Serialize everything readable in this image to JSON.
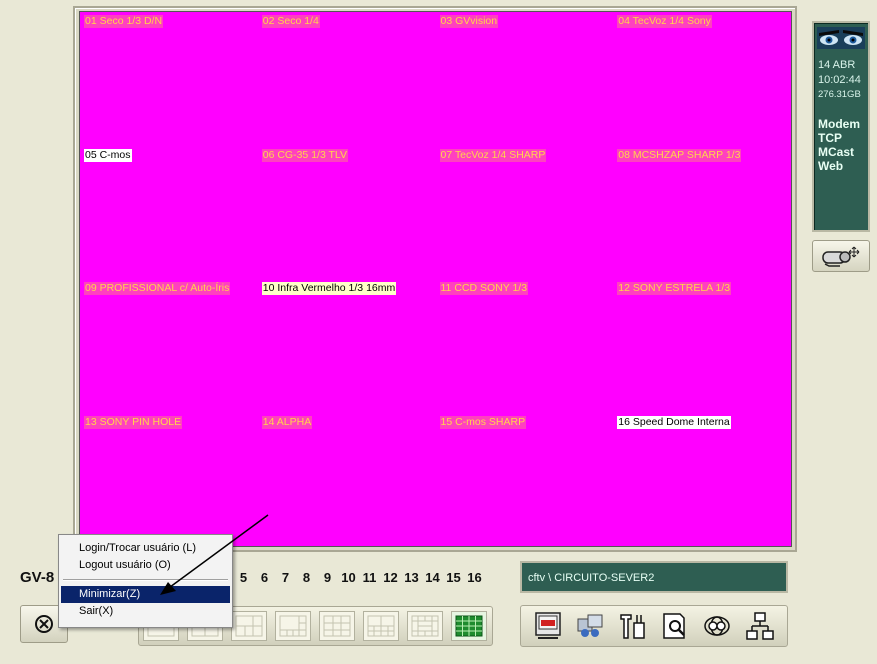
{
  "cameras": [
    {
      "label": "01 Seco 1/3 D/N",
      "state": "off"
    },
    {
      "label": "02 Seco 1/4",
      "state": "off"
    },
    {
      "label": "03 GVvision",
      "state": "off"
    },
    {
      "label": "04 TecVoz 1/4 Sony",
      "state": "off"
    },
    {
      "label": "05 C-mos",
      "state": "on"
    },
    {
      "label": "06 CG-35 1/3 TLV",
      "state": "off"
    },
    {
      "label": "07 TecVoz 1/4 SHARP",
      "state": "off"
    },
    {
      "label": "08 MCSHZAP SHARP 1/3",
      "state": "off"
    },
    {
      "label": "09 PROFISSIONAL c/ Auto-Íris",
      "state": "off"
    },
    {
      "label": "10 Infra Vermelho 1/3 16mm",
      "state": "on-yellow"
    },
    {
      "label": "11 CCD SONY 1/3",
      "state": "off"
    },
    {
      "label": "12 SONY ESTRELA 1/3",
      "state": "off"
    },
    {
      "label": "13 SONY PIN HOLE",
      "state": "off"
    },
    {
      "label": "14 ALPHA",
      "state": "off"
    },
    {
      "label": "15 C-mos SHARP",
      "state": "off"
    },
    {
      "label": "16 Speed Dome Interna",
      "state": "on"
    }
  ],
  "status": {
    "date": "14 ABR",
    "time": "10:02:44",
    "disk": "276.31GB",
    "services": [
      "Modem",
      "TCP",
      "MCast",
      "Web"
    ]
  },
  "brand": "GV-8",
  "camera_numbers": [
    "5",
    "6",
    "7",
    "8",
    "9",
    "10",
    "11",
    "12",
    "13",
    "14",
    "15",
    "16"
  ],
  "path": "cftv \\ CIRCUITO-SEVER2",
  "context_menu": {
    "items": [
      "Login/Trocar usuário (L)",
      "Logout usuário (O)",
      "Minimizar(Z)",
      "Sair(X)"
    ],
    "highlighted": "Minimizar(Z)"
  },
  "icons": {
    "exit": "exit-icon",
    "ptz": "ptz-control-icon",
    "tools": [
      "rec-icon",
      "playback-icon",
      "config-icon",
      "search-icon",
      "network-icon",
      "hierarchy-icon"
    ]
  },
  "colors": {
    "video_bg": "#ff00ff",
    "panel": "#2e5e52",
    "label_off": "#ffd54a",
    "menu_highlight": "#0a246a"
  }
}
